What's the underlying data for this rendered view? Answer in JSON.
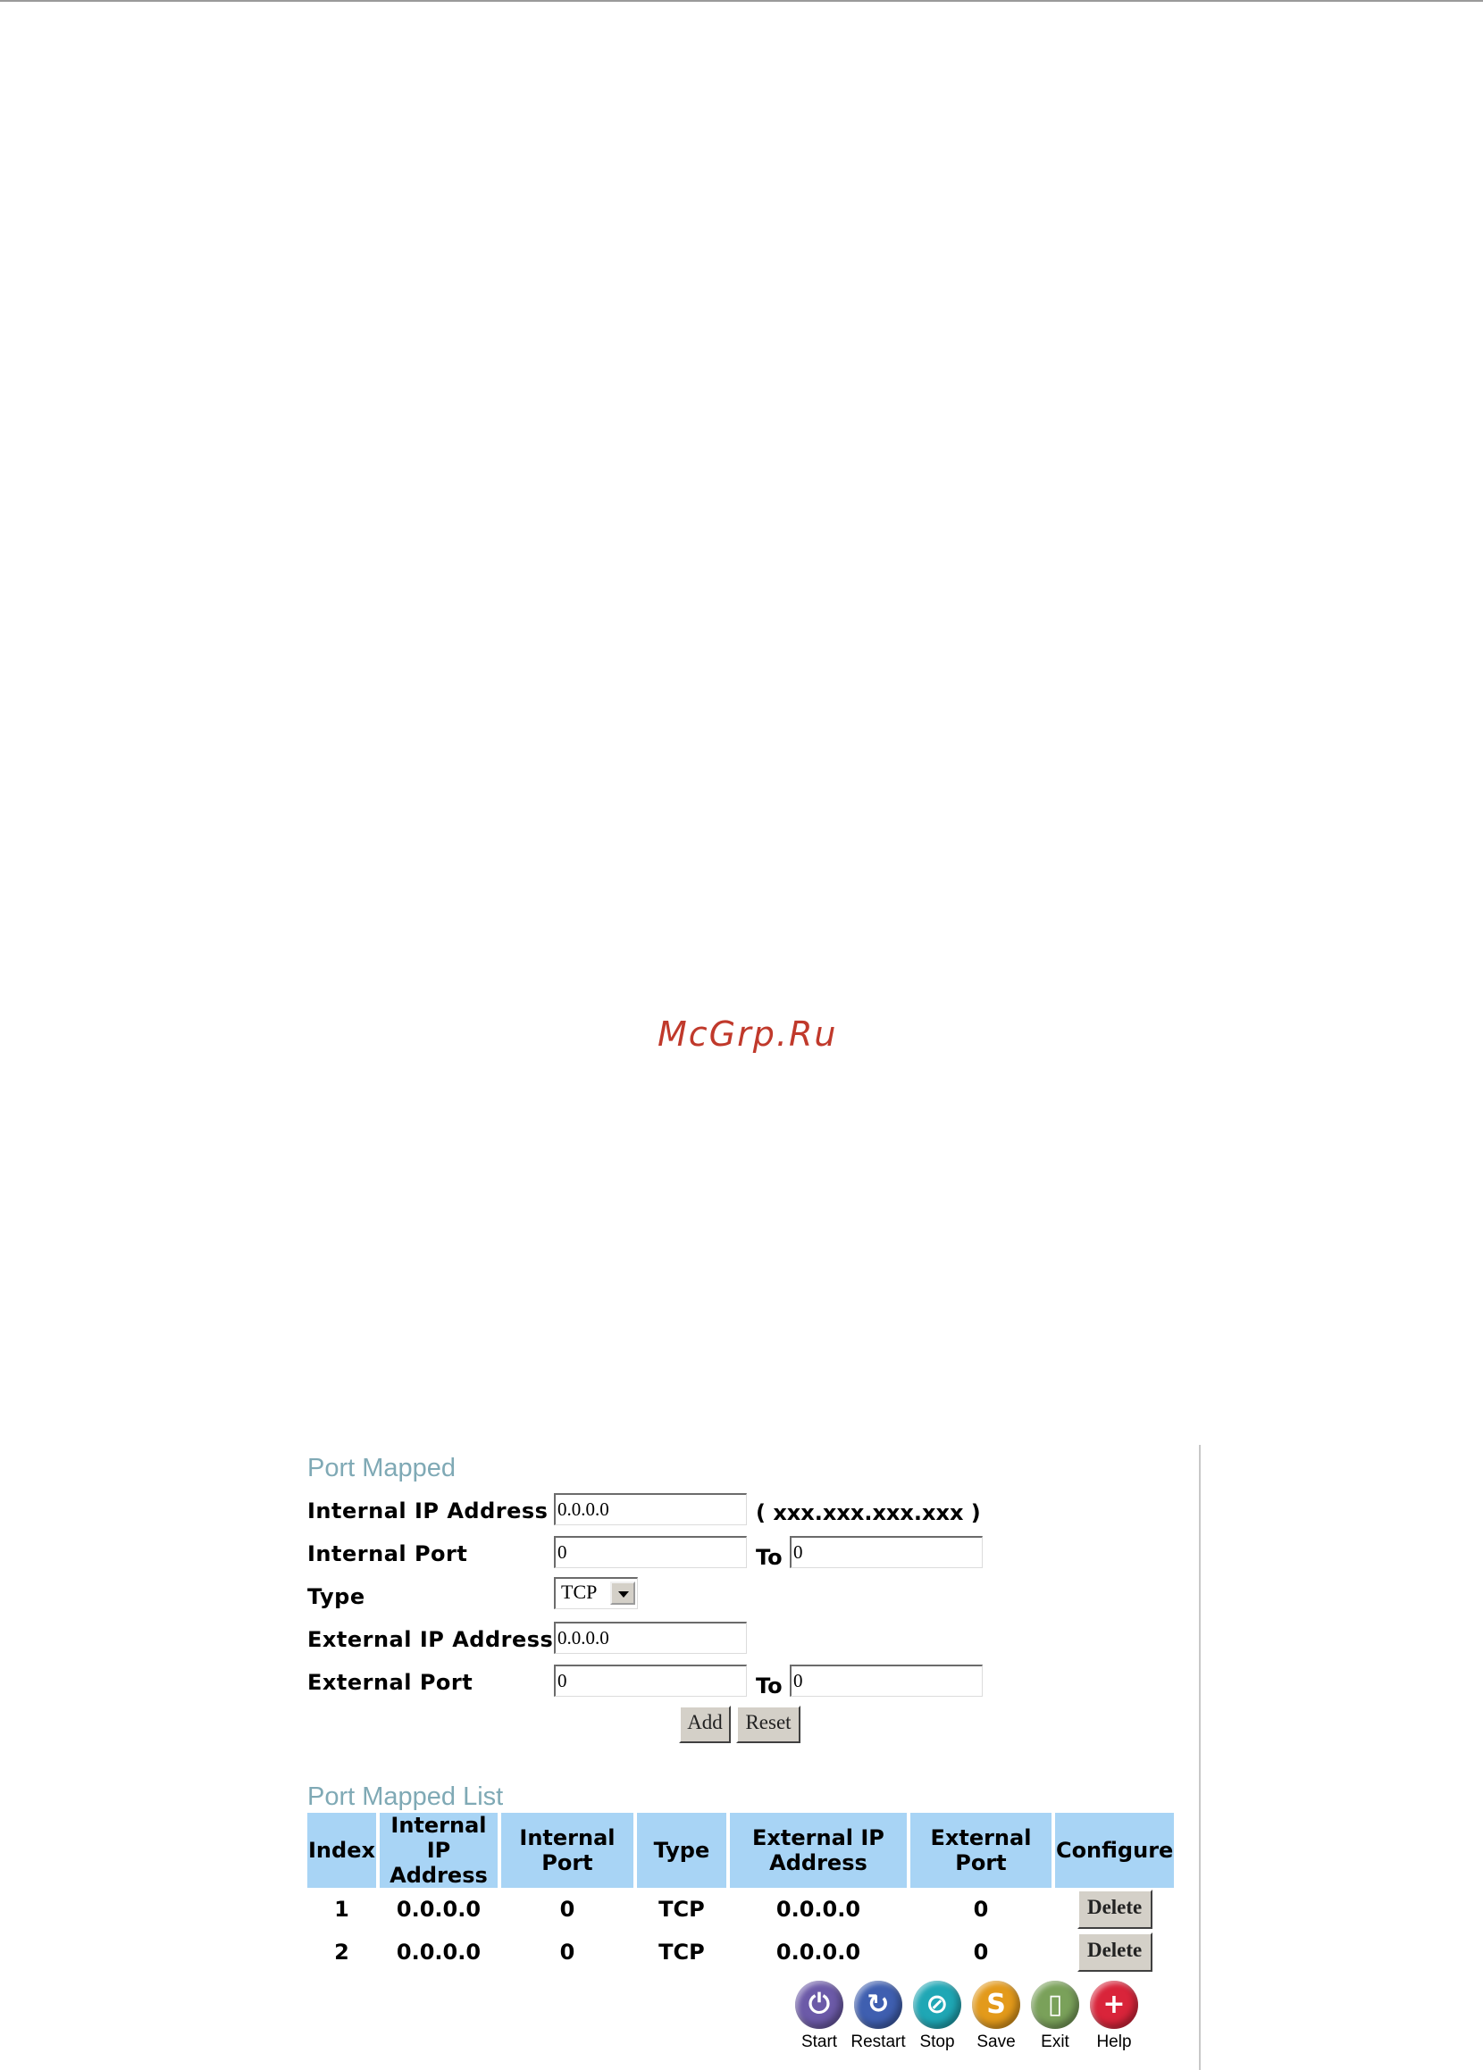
{
  "watermark": "McGrp.Ru",
  "port_mapped": {
    "title": "Port Mapped",
    "internal_ip_label": "Internal IP Address",
    "internal_ip_value": "0.0.0.0",
    "internal_ip_hint": "( xxx.xxx.xxx.xxx )",
    "internal_port_label": "Internal Port",
    "internal_port_from": "0",
    "internal_port_to_label": "To",
    "internal_port_to": "0",
    "type_label": "Type",
    "type_value": "TCP",
    "external_ip_label": "External IP Address",
    "external_ip_value": "0.0.0.0",
    "external_port_label": "External Port",
    "external_port_from": "0",
    "external_port_to_label": "To",
    "external_port_to": "0",
    "add_label": "Add",
    "reset_label": "Reset"
  },
  "port_mapped_list": {
    "title": "Port Mapped List",
    "headers": {
      "index": "Index",
      "internal_ip_1": "Internal IP",
      "internal_ip_2": "Address",
      "internal_port_1": "Internal",
      "internal_port_2": "Port",
      "type": "Type",
      "external_ip_1": "External IP",
      "external_ip_2": "Address",
      "external_port_1": "External",
      "external_port_2": "Port",
      "configure": "Configure"
    },
    "rows": [
      {
        "index": "1",
        "internal_ip": "0.0.0.0",
        "internal_port": "0",
        "type": "TCP",
        "external_ip": "0.0.0.0",
        "external_port": "0",
        "action": "Delete"
      },
      {
        "index": "2",
        "internal_ip": "0.0.0.0",
        "internal_port": "0",
        "type": "TCP",
        "external_ip": "0.0.0.0",
        "external_port": "0",
        "action": "Delete"
      }
    ]
  },
  "toolbar": {
    "start": "Start",
    "restart": "Restart",
    "stop": "Stop",
    "save": "Save",
    "exit": "Exit",
    "help": "Help"
  },
  "colors": {
    "section_title": "#7fa9b5",
    "table_header": "#a8d4f5",
    "watermark": "#c0392b",
    "start_icon": "#6c5aa8",
    "restart_icon": "#3f5fb0",
    "stop_icon": "#1fa7b5",
    "save_icon": "#e39a1b",
    "exit_icon": "#7aa15a",
    "help_icon": "#d9243a"
  }
}
